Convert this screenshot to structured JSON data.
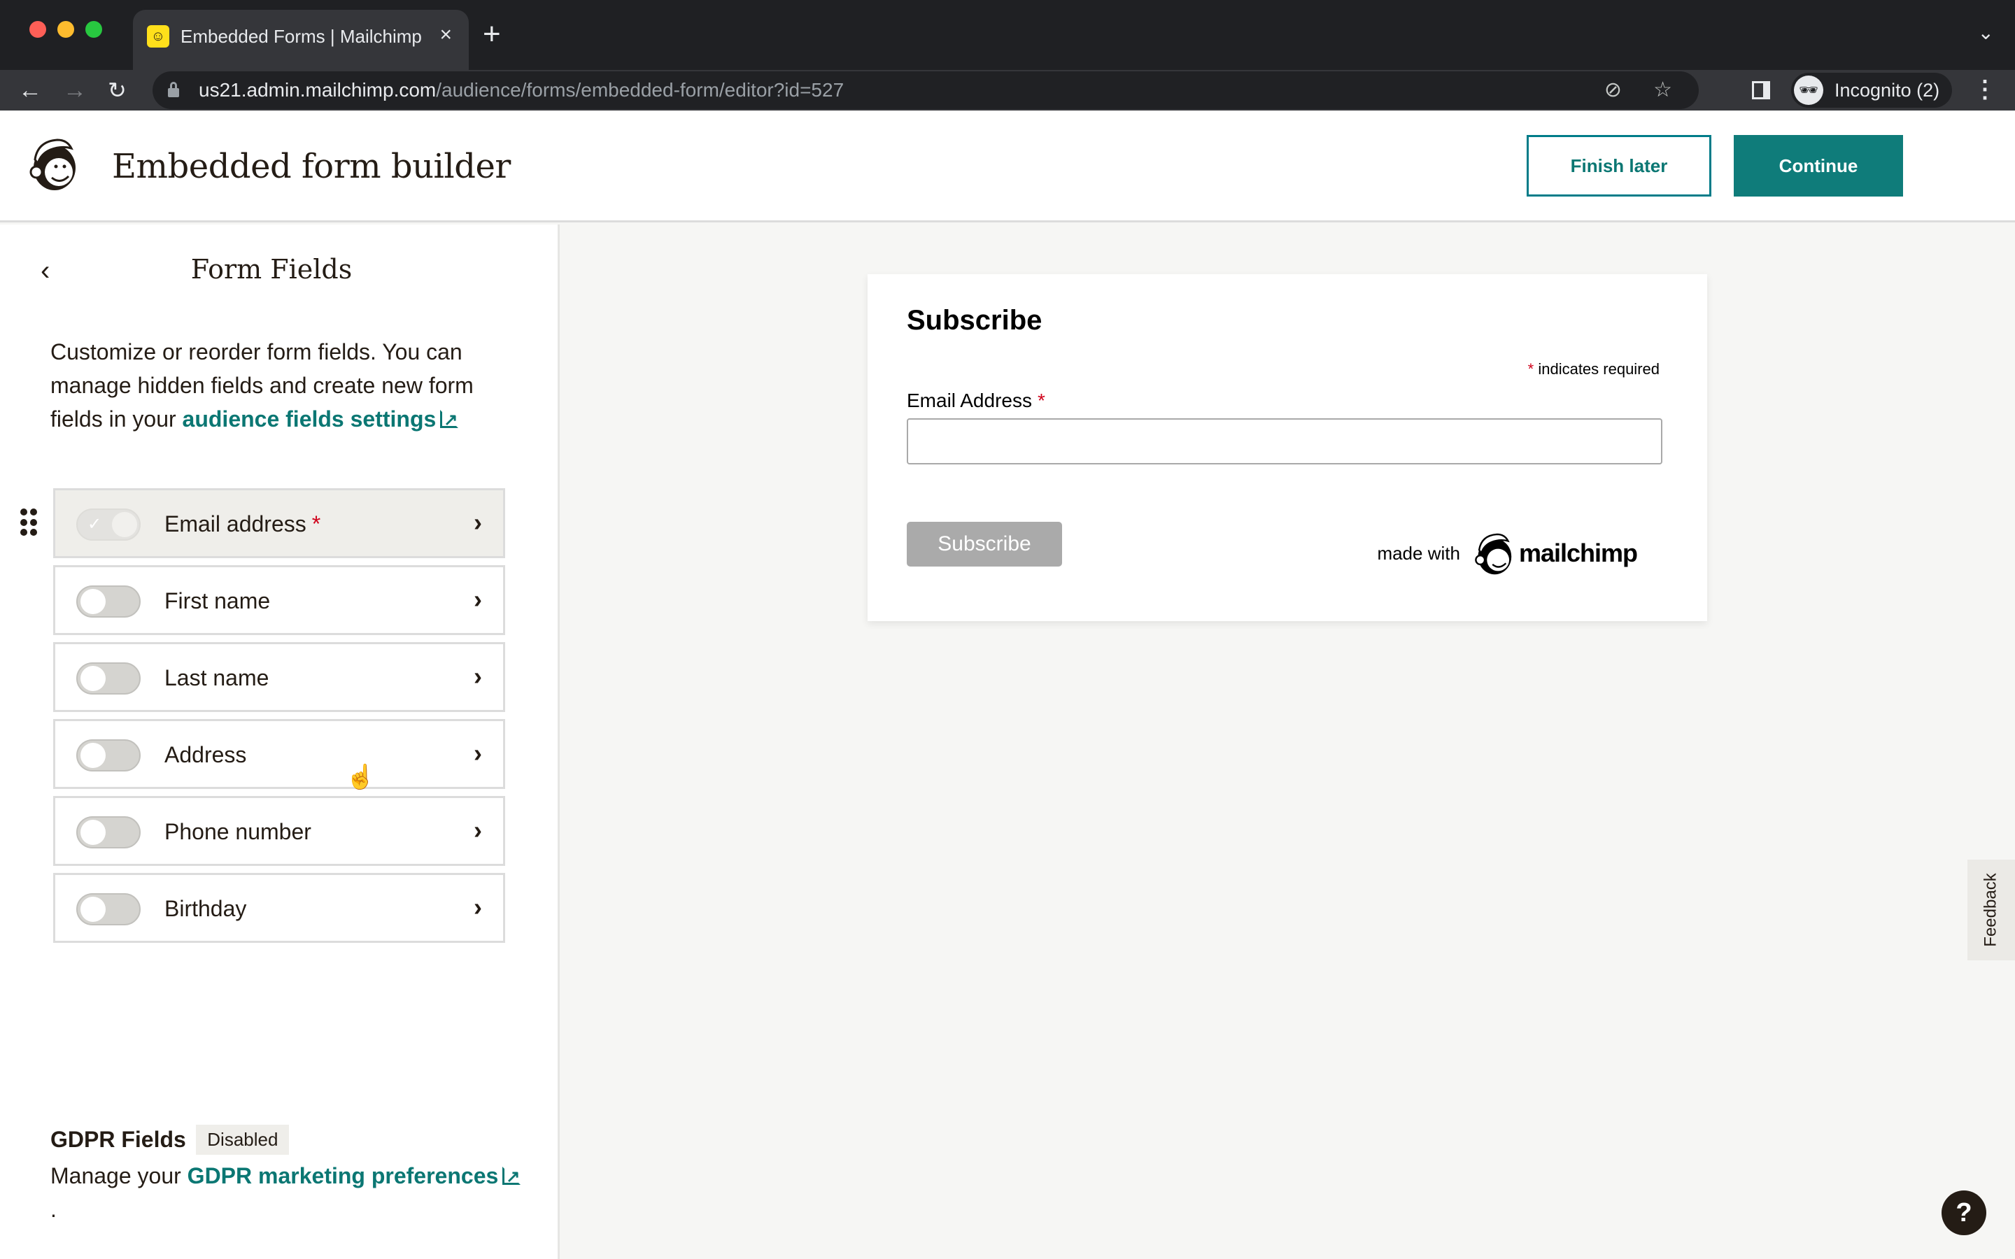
{
  "browser": {
    "tab_title": "Embedded Forms | Mailchimp",
    "tab_close": "×",
    "new_tab": "+",
    "url_host": "us21.admin.mailchimp.com",
    "url_path": "/audience/forms/embedded-form/editor?id=527",
    "profile_label": "Incognito (2)",
    "icons": {
      "back": "←",
      "forward": "→",
      "reload": "↻",
      "eye_off": "⊘",
      "star": "☆",
      "menu": "⋮",
      "tab_list": "⌄",
      "incognito": "🕶"
    }
  },
  "header": {
    "title": "Embedded form builder",
    "finish_later": "Finish later",
    "continue": "Continue"
  },
  "sidebar": {
    "back_icon": "‹",
    "title": "Form Fields",
    "description": "Customize or reorder form fields. You can manage hidden fields and create new form fields in your ",
    "description_link": "audience fields settings",
    "fields": [
      {
        "label": "Email address",
        "required": true,
        "enabled": true,
        "locked": true
      },
      {
        "label": "First name",
        "required": false,
        "enabled": false
      },
      {
        "label": "Last name",
        "required": false,
        "enabled": false
      },
      {
        "label": "Address",
        "required": false,
        "enabled": false
      },
      {
        "label": "Phone number",
        "required": false,
        "enabled": false
      },
      {
        "label": "Birthday",
        "required": false,
        "enabled": false
      }
    ],
    "required_marker": "*",
    "chevron": "›",
    "gdpr": {
      "title": "GDPR Fields",
      "badge": "Disabled",
      "text_prefix": "Manage your ",
      "link": "GDPR marketing preferences",
      "text_suffix": " ."
    }
  },
  "preview": {
    "title": "Subscribe",
    "required_note_star": "*",
    "required_note": " indicates required",
    "email_label": "Email Address",
    "email_value": "",
    "button": "Subscribe",
    "made_with": "made with",
    "brand": "mailchimp"
  },
  "feedback": "Feedback",
  "help": "?",
  "colors": {
    "accent": "#007c89",
    "primary_button": "#0f7c7a",
    "required": "#d0021b",
    "toolbar": "#35363a"
  }
}
